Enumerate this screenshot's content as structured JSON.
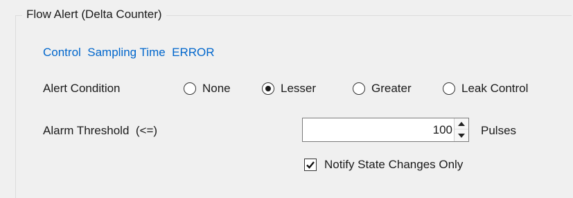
{
  "group": {
    "title": "Flow Alert (Delta Counter)"
  },
  "error_message": "Control  Sampling Time  ERROR",
  "alert_condition": {
    "label": "Alert Condition",
    "options": [
      {
        "label": "None",
        "checked": false
      },
      {
        "label": "Lesser",
        "checked": true
      },
      {
        "label": "Greater",
        "checked": false
      },
      {
        "label": "Leak Control",
        "checked": false
      }
    ]
  },
  "threshold": {
    "label": "Alarm Threshold  (<=)",
    "value": "100",
    "unit": "Pulses"
  },
  "notify": {
    "label": "Notify State Changes Only",
    "checked": true
  },
  "icons": {
    "spin_up": "chevron-up-icon",
    "spin_down": "chevron-down-icon",
    "check": "checkmark-icon"
  }
}
